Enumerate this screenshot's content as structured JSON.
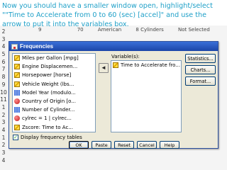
{
  "instruction": {
    "text": "Now you should have a smaller window open, highlight/select \"\"Time to Accelerate from 0 to 60 (sec) [accel]\" and use the arrow to put it into the variables box."
  },
  "background": {
    "row_numbers": [
      "2",
      "3",
      "4",
      "5",
      "6",
      "7",
      "8",
      "9",
      "10",
      "11",
      "1",
      "2",
      "3",
      "4",
      "1",
      "2",
      "3",
      "4"
    ],
    "peek_values": [
      "9",
      "70",
      "American",
      "8 Cylinders",
      "Not Selected"
    ]
  },
  "dialog": {
    "title": "Frequencies",
    "variables_caption": "Variable(s):",
    "source_list": [
      {
        "label": "Miles per Gallon [mpg]",
        "icon": "scale-icon"
      },
      {
        "label": "Engine Displacemen...",
        "icon": "scale-icon"
      },
      {
        "label": "Horsepower [horse]",
        "icon": "scale-icon"
      },
      {
        "label": "Vehicle Weight (lbs...",
        "icon": "scale-icon"
      },
      {
        "label": "Model Year (modulo...",
        "icon": "ordinal-icon"
      },
      {
        "label": "Country of Origin [o...",
        "icon": "nominal-icon"
      },
      {
        "label": "Number of Cylinder...",
        "icon": "ordinal-icon"
      },
      {
        "label": "cylrec = 1 | cylrec...",
        "icon": "nominal-icon"
      },
      {
        "label": "Zscore:  Time to Ac...",
        "icon": "scale-icon"
      }
    ],
    "selected_list": [
      {
        "label": "Time to Accelerate fro...",
        "icon": "scale-icon"
      }
    ],
    "move_arrow_glyph": "◄",
    "side_buttons": {
      "statistics": "Statistics...",
      "charts": "Charts...",
      "format": "Format..."
    },
    "checkbox": {
      "label": "Display frequency tables",
      "checked": true,
      "mark": "✓"
    },
    "bottom_buttons": {
      "ok": "OK",
      "paste": "Paste",
      "reset": "Reset",
      "cancel": "Cancel",
      "help": "Help"
    }
  }
}
